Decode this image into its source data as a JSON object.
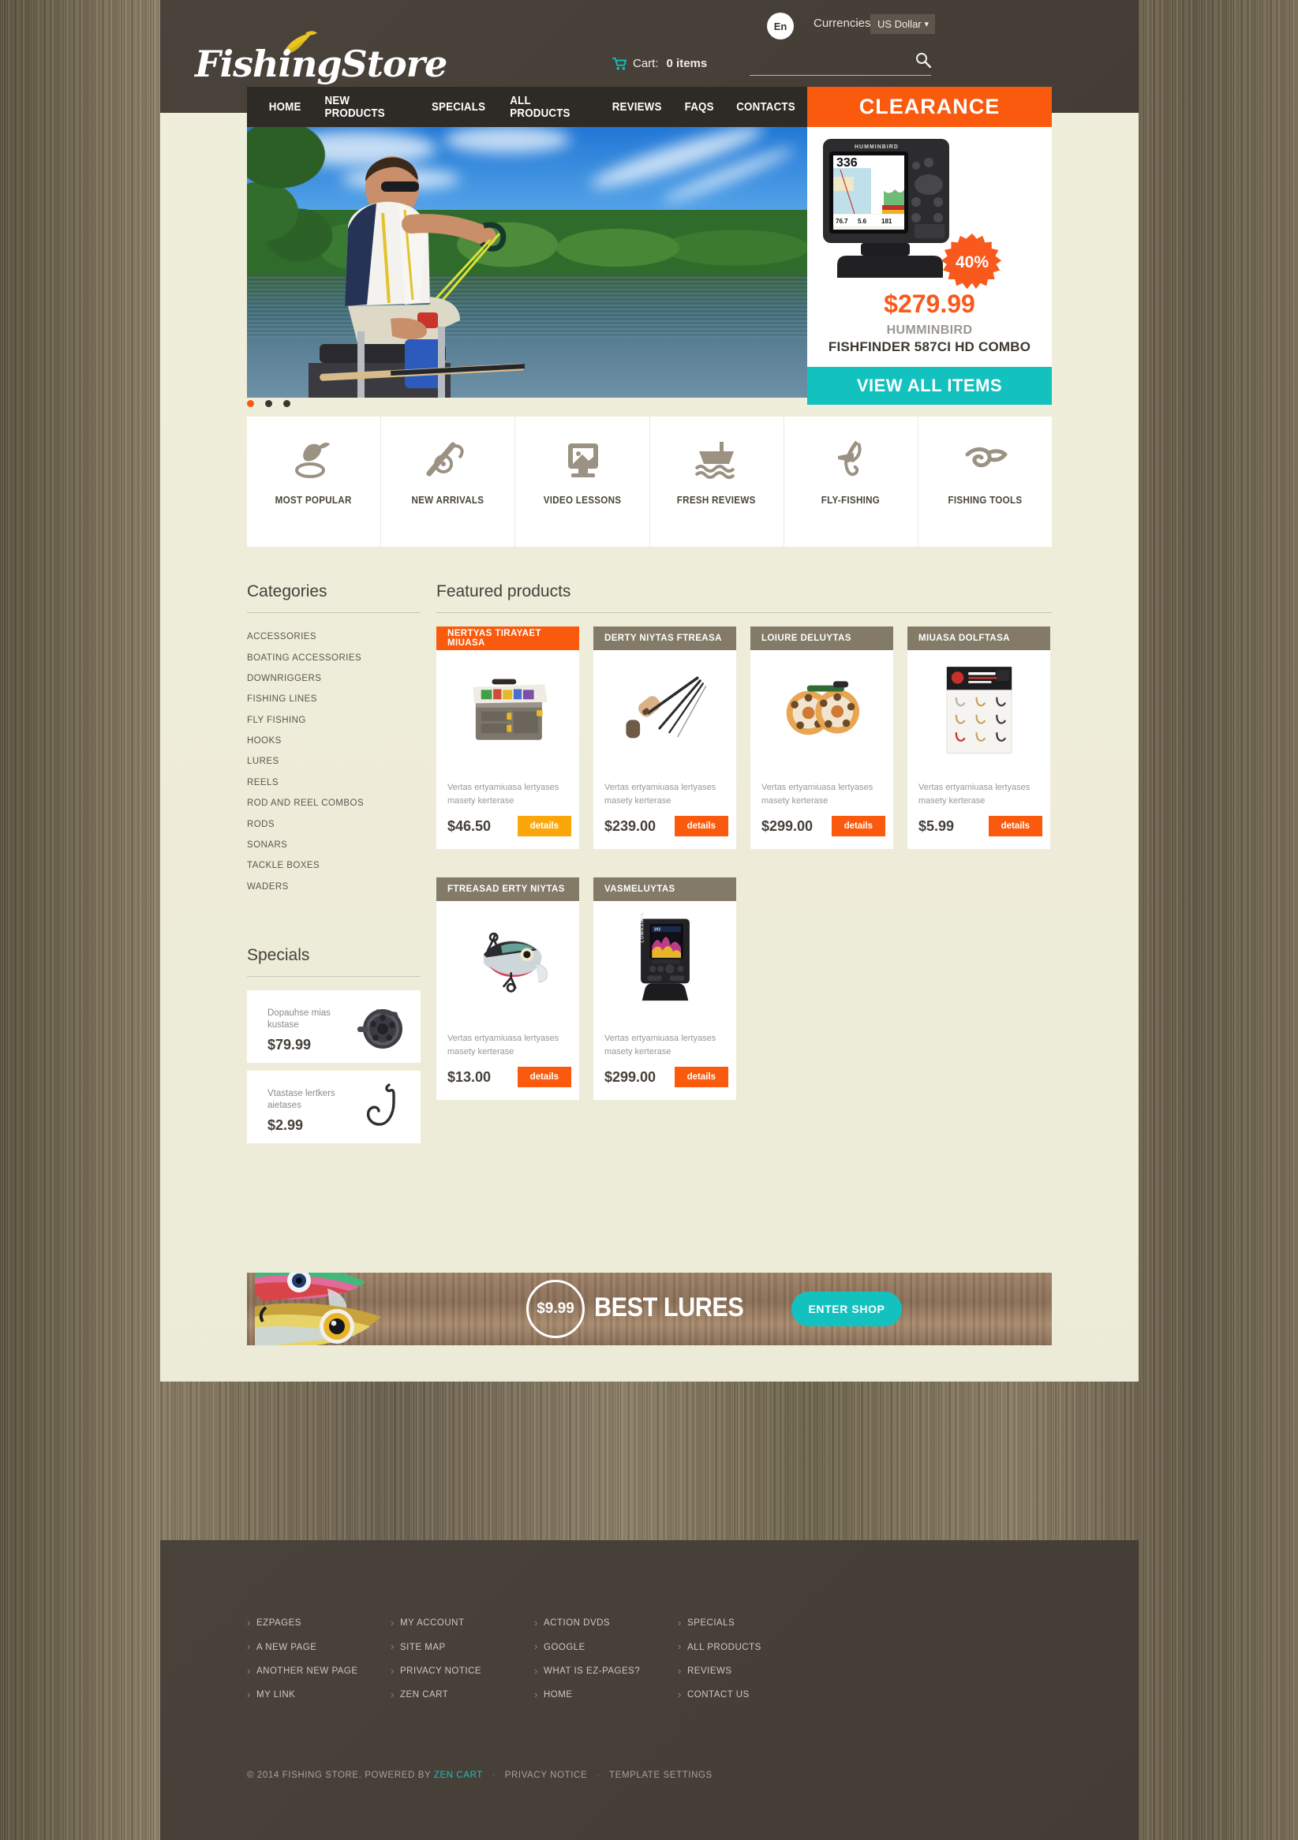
{
  "header": {
    "logo_text": "FishingStore",
    "lang_badge": "En",
    "currency_label": "Currencies:",
    "currency_value": "US Dollar",
    "cart_label": "Cart:",
    "cart_count": "0 items",
    "search_placeholder": ""
  },
  "nav": {
    "items": [
      {
        "label": "HOME"
      },
      {
        "label": "NEW PRODUCTS"
      },
      {
        "label": "SPECIALS"
      },
      {
        "label": "ALL PRODUCTS"
      },
      {
        "label": "REVIEWS"
      },
      {
        "label": "FAQS"
      },
      {
        "label": "CONTACTS"
      }
    ],
    "clearance_label": "CLEARANCE"
  },
  "hero": {
    "discount": "40%",
    "price": "$279.99",
    "brand": "HUMMINBIRD",
    "model": "FISHFINDER 587CI HD COMBO",
    "view_all_label": "VIEW ALL ITEMS",
    "slides": 3,
    "active_slide": 1
  },
  "iconnav": [
    {
      "icon": "float-bobber-icon",
      "label": "MOST POPULAR"
    },
    {
      "icon": "fishing-rod-reel-icon",
      "label": "NEW ARRIVALS"
    },
    {
      "icon": "video-monitor-icon",
      "label": "VIDEO LESSONS"
    },
    {
      "icon": "boat-waves-icon",
      "label": "FRESH REVIEWS"
    },
    {
      "icon": "fly-hook-icon",
      "label": "FLY-FISHING"
    },
    {
      "icon": "fishing-knot-icon",
      "label": "FISHING TOOLS"
    }
  ],
  "sidebar": {
    "categories_title": "Categories",
    "categories": [
      "ACCESSORIES",
      "BOATING ACCESSORIES",
      "DOWNRIGGERS",
      "FISHING LINES",
      "FLY FISHING",
      "HOOKS",
      "LURES",
      "REELS",
      "ROD AND REEL COMBOS",
      "RODS",
      "SONARS",
      "TACKLE BOXES",
      "WADERS"
    ],
    "specials_title": "Specials",
    "specials": [
      {
        "name": "Dopauhse mias kustase",
        "price": "$79.99",
        "image": "fly-reel-image"
      },
      {
        "name": "Vtastase lertkers aietases",
        "price": "$2.99",
        "image": "fish-hook-image"
      }
    ]
  },
  "featured": {
    "title": "Featured products",
    "details_label": "details",
    "description": "Vertas ertyamiuasa lertyases masety kerterase",
    "products": [
      {
        "name": "NERTYAS TIRAYAET MIUASA",
        "price": "$46.50",
        "image": "tackle-box-image",
        "highlighted": true
      },
      {
        "name": "DERTY NIYTAS FTREASA",
        "price": "$239.00",
        "image": "fly-rod-image",
        "highlighted": false
      },
      {
        "name": "LOIURE DELUYTAS",
        "price": "$299.00",
        "image": "fly-reels-image",
        "highlighted": false
      },
      {
        "name": "MIUASA DOLFTASA",
        "price": "$5.99",
        "image": "hook-kit-image",
        "highlighted": false
      },
      {
        "name": "FTREASAD ERTY NIYTAS",
        "price": "$13.00",
        "image": "crankbait-lure-image",
        "highlighted": false
      },
      {
        "name": "VASMELUYTAS",
        "price": "$299.00",
        "image": "lowrance-fishfinder-image",
        "highlighted": false
      }
    ]
  },
  "promo": {
    "price": "$9.99",
    "title": "BEST LURES",
    "button_label": "ENTER SHOP"
  },
  "footer": {
    "columns": [
      [
        "EZPAGES",
        "A NEW PAGE",
        "ANOTHER NEW PAGE",
        "MY LINK"
      ],
      [
        "MY ACCOUNT",
        "SITE MAP",
        "PRIVACY NOTICE",
        "ZEN CART"
      ],
      [
        "ACTION DVDS",
        "GOOGLE",
        "WHAT IS EZ-PAGES?",
        "HOME"
      ],
      [
        "SPECIALS",
        "ALL PRODUCTS",
        "REVIEWS",
        "CONTACT US"
      ]
    ],
    "copyright_prefix": "© 2014 FISHING STORE. POWERED BY",
    "copyright_brand": "ZEN CART",
    "copyright_links": [
      "PRIVACY NOTICE",
      "TEMPLATE SETTINGS"
    ]
  },
  "colors": {
    "accent_orange": "#f95a0d",
    "accent_teal": "#13c2bf",
    "dark_brown": "#463f37",
    "nav_dark": "#2e2a25",
    "page_bg": "#efeeda",
    "card_head": "#847a68",
    "logo_fish": "#e8c520"
  }
}
